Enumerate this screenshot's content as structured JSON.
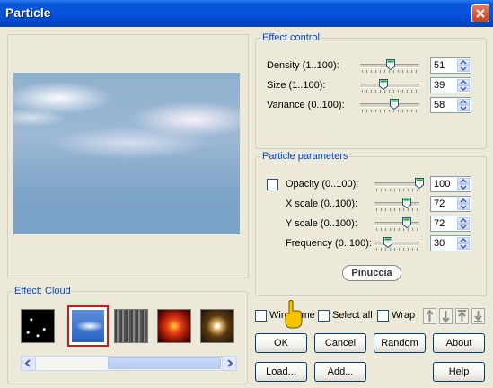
{
  "window": {
    "title": "Particle"
  },
  "effect_control": {
    "legend": "Effect control",
    "rows": [
      {
        "label": "Density (1..100):",
        "value": "51",
        "slider_fraction": 0.51
      },
      {
        "label": "Size (1..100):",
        "value": "39",
        "slider_fraction": 0.39
      },
      {
        "label": "Variance (0..100):",
        "value": "58",
        "slider_fraction": 0.58
      }
    ]
  },
  "particle_parameters": {
    "legend": "Particle parameters",
    "rows": [
      {
        "label": "Opacity (0..100):",
        "value": "100",
        "slider_fraction": 1.0,
        "checkbox": true
      },
      {
        "label": "X scale (0..100):",
        "value": "72",
        "slider_fraction": 0.72
      },
      {
        "label": "Y scale (0..100):",
        "value": "72",
        "slider_fraction": 0.72
      },
      {
        "label": "Frequency (0..100):",
        "value": "30",
        "slider_fraction": 0.3
      }
    ]
  },
  "effect_group": {
    "legend": "Effect: Cloud",
    "selected_index": 1
  },
  "options": {
    "wireframe": "Wireframe",
    "select_all": "Select all",
    "wrap": "Wrap"
  },
  "buttons": {
    "ok": "OK",
    "cancel": "Cancel",
    "random": "Random",
    "about": "About",
    "load": "Load...",
    "add": "Add...",
    "help": "Help"
  },
  "watermark": "Pinuccia",
  "colors": {
    "title_bar": "#0553de",
    "legend_text": "#0046d5",
    "selected_border": "#cc1a1a"
  }
}
